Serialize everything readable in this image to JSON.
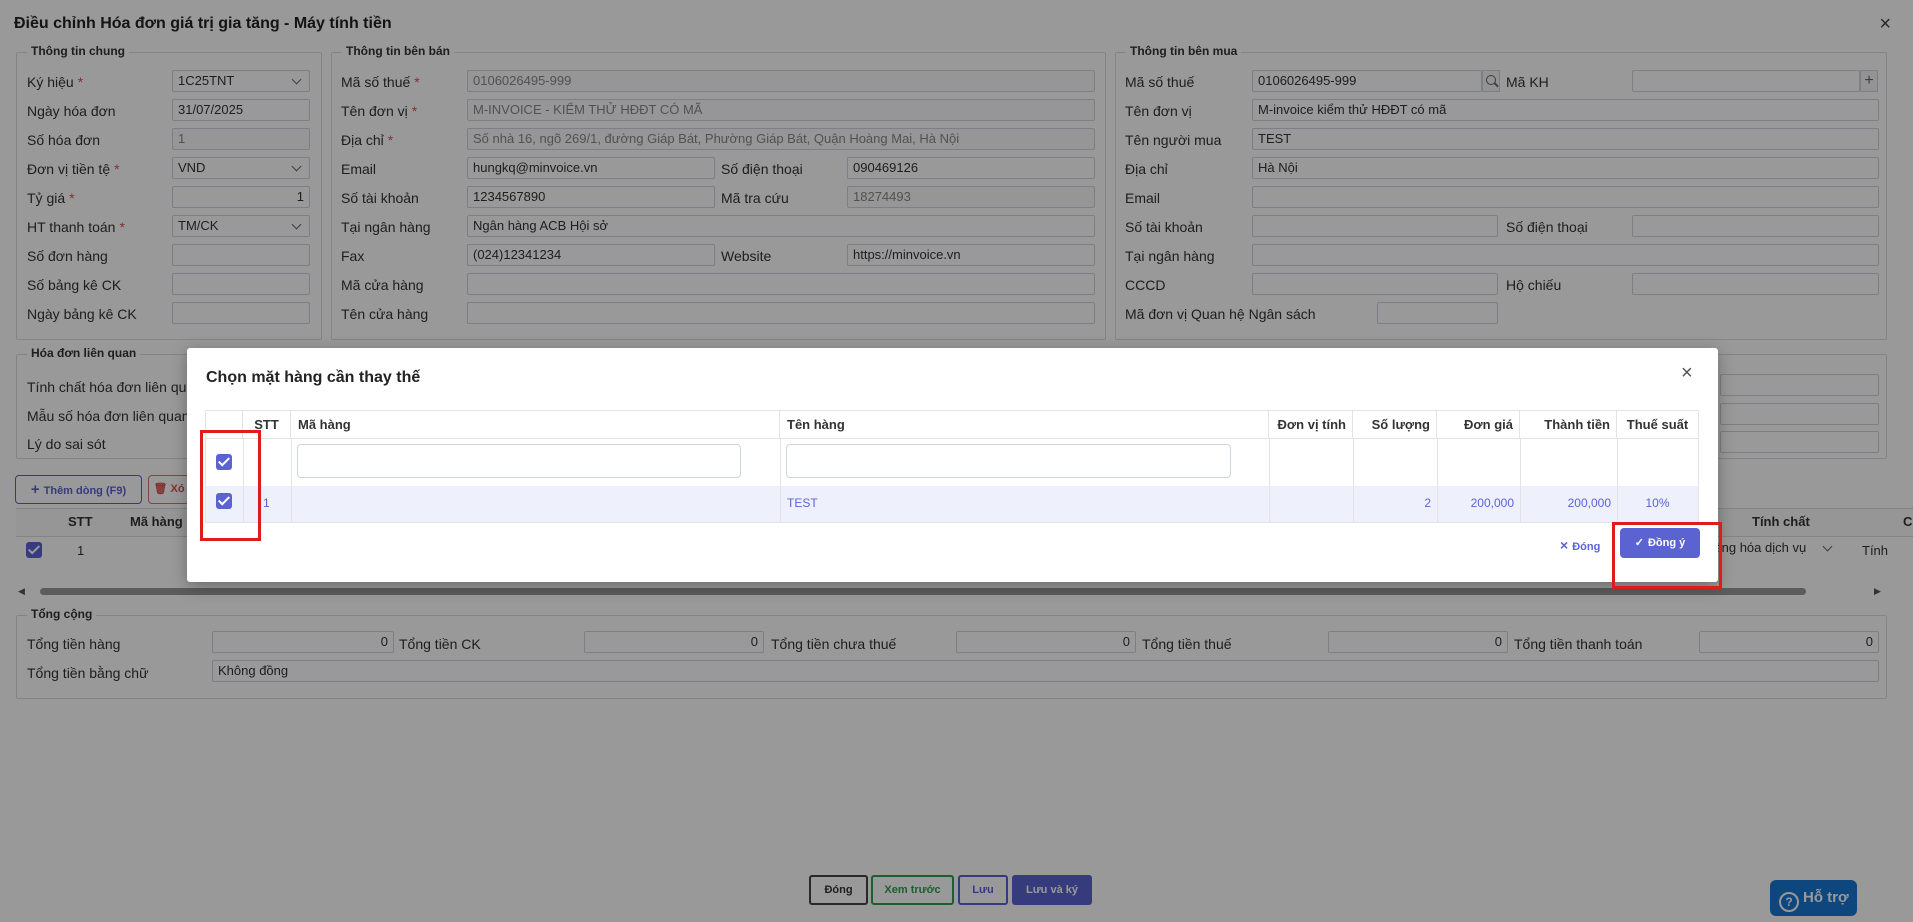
{
  "window": {
    "title": "Điều chỉnh Hóa đơn giá trị gia tăng - Máy tính tiền",
    "close": "×"
  },
  "general": {
    "legend": "Thông tin chung",
    "ky_hieu_label": "Ký hiệu",
    "ky_hieu": "1C25TNT",
    "ngay_label": "Ngày hóa đơn",
    "ngay": "31/07/2025",
    "so_hd_label": "Số hóa đơn",
    "so_hd": "1",
    "tien_te_label": "Đơn vị tiền tệ",
    "tien_te": "VND",
    "ty_gia_label": "Tỷ giá",
    "ty_gia": "1",
    "httt_label": "HT thanh toán",
    "httt": "TM/CK",
    "so_don_hang_label": "Số đơn hàng",
    "so_bang_ke_label": "Số bảng kê CK",
    "ngay_bang_ke_label": "Ngày bảng kê CK"
  },
  "seller": {
    "legend": "Thông tin bên bán",
    "mst_label": "Mã số thuế",
    "mst": "0106026495-999",
    "ten_label": "Tên đơn vị",
    "ten": "M-INVOICE - KIỂM THỬ HĐĐT CÓ MÃ",
    "dia_chi_label": "Địa chỉ",
    "dia_chi": "Số nhà 16, ngõ 269/1, đường Giáp Bát, Phường Giáp Bát, Quận Hoàng Mai, Hà Nội",
    "email_label": "Email",
    "email": "hungkq@minvoice.vn",
    "sdt_label": "Số điện thoại",
    "sdt": "090469126",
    "stk_label": "Số tài khoản",
    "stk": "1234567890",
    "ma_tra_cuu_label": "Mã tra cứu",
    "ma_tra_cuu": "18274493",
    "ngan_hang_label": "Tại ngân hàng",
    "ngan_hang": "Ngân hàng ACB Hội sở",
    "fax_label": "Fax",
    "fax": "(024)12341234",
    "website_label": "Website",
    "website": "https://minvoice.vn",
    "ma_cua_hang_label": "Mã cửa hàng",
    "ten_cua_hang_label": "Tên cửa hàng"
  },
  "buyer": {
    "legend": "Thông tin bên mua",
    "mst_label": "Mã số thuế",
    "mst": "0106026495-999",
    "ma_kh_label": "Mã KH",
    "ten_label": "Tên đơn vị",
    "ten": "M-invoice kiểm thử HĐĐT có mã",
    "nguoi_mua_label": "Tên người mua",
    "nguoi_mua": "TEST",
    "dia_chi_label": "Địa chỉ",
    "dia_chi": "Hà Nội",
    "email_label": "Email",
    "stk_label": "Số tài khoản",
    "sdt_label": "Số điện thoại",
    "ngan_hang_label": "Tại ngân hàng",
    "cccd_label": "CCCD",
    "ho_chieu_label": "Hộ chiếu",
    "ns_label": "Mã đơn vị Quan hệ Ngân sách"
  },
  "related": {
    "legend": "Hóa đơn liên quan",
    "tinh_chat_label": "Tính chất hóa đơn liên qua",
    "mau_so_label": "Mẫu số hóa đơn liên quan",
    "ly_do_label": "Lý do sai sót"
  },
  "detail": {
    "add_row": "Thêm dòng (F9)",
    "delete_row": "Xó",
    "col_stt": "STT",
    "col_ma_hang": "Mã hàng",
    "col_tinh_chat": "Tính chất",
    "col_cut": "C",
    "row_stt": "1",
    "row_tinh_chat": "Hàng hóa dịch vụ",
    "row_cut": "Tính"
  },
  "totals": {
    "legend": "Tổng cộng",
    "tong_hang_label": "Tổng tiền hàng",
    "tong_hang": "0",
    "tong_ck_label": "Tổng tiền CK",
    "tong_ck": "0",
    "chua_thue_label": "Tổng tiền chưa thuế",
    "chua_thue": "0",
    "thue_label": "Tổng tiền thuế",
    "thue": "0",
    "thanh_toan_label": "Tổng tiền thanh toán",
    "thanh_toan": "0",
    "bang_chu_label": "Tổng tiền bằng chữ",
    "bang_chu": "Không đồng"
  },
  "footer": {
    "close": "Đóng",
    "preview": "Xem trước",
    "save": "Lưu",
    "save_sign": "Lưu và ký",
    "help": "Hỗ trợ"
  },
  "modal": {
    "title": "Chọn mặt hàng cần thay thế",
    "close": "×",
    "headers": {
      "stt": "STT",
      "ma_hang": "Mã hàng",
      "ten_hang": "Tên hàng",
      "dvt": "Đơn vị tính",
      "so_luong": "Số lượng",
      "don_gia": "Đơn giá",
      "thanh_tien": "Thành tiền",
      "thue_suat": "Thuế suất"
    },
    "row": {
      "stt": "1",
      "ma_hang": "",
      "ten_hang": "TEST",
      "dvt": "",
      "so_luong": "2",
      "don_gia": "200,000",
      "thanh_tien": "200,000",
      "thue_suat": "10%"
    },
    "btn_close": "Đóng",
    "btn_ok": "Đồng ý"
  },
  "colors": {
    "accent": "#5b63d3",
    "highlight": "#e01b1b"
  }
}
